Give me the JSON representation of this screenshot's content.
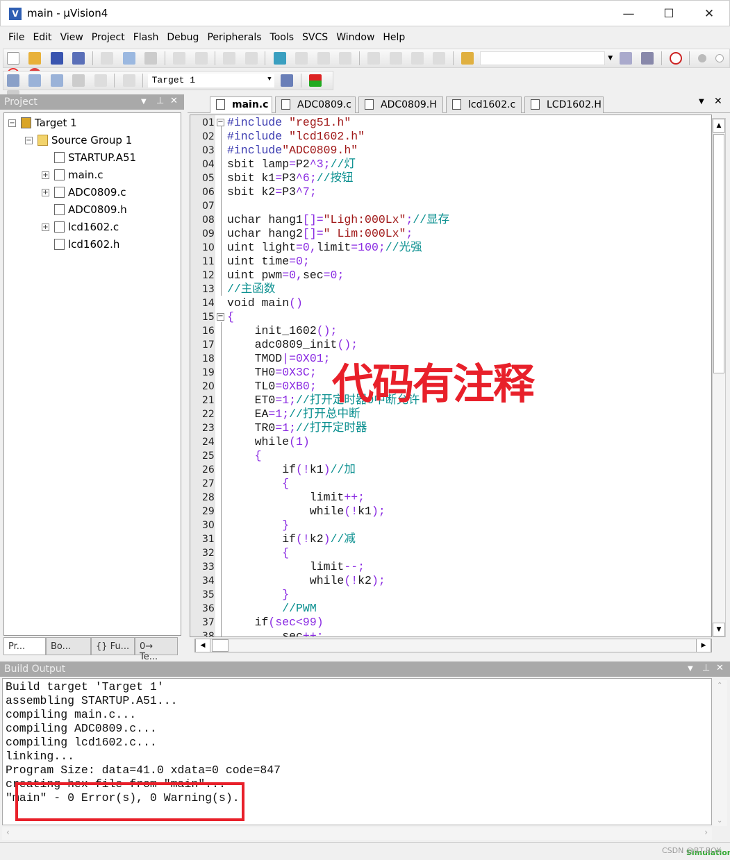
{
  "window": {
    "title": "main  - µVision4",
    "app_icon": "uv4-icon",
    "controls": [
      "minimize",
      "maximize",
      "close"
    ]
  },
  "menu": [
    "File",
    "Edit",
    "View",
    "Project",
    "Flash",
    "Debug",
    "Peripherals",
    "Tools",
    "SVCS",
    "Window",
    "Help"
  ],
  "toolbar2": {
    "target_select": "Target 1"
  },
  "project_panel": {
    "title": "Project",
    "tree": [
      {
        "label": "Target 1",
        "level": 0,
        "expander": "-"
      },
      {
        "label": "Source Group 1",
        "level": 1,
        "expander": "-"
      },
      {
        "label": "STARTUP.A51",
        "level": 2,
        "expander": ""
      },
      {
        "label": "main.c",
        "level": 2,
        "expander": "+"
      },
      {
        "label": "ADC0809.c",
        "level": 2,
        "expander": "+"
      },
      {
        "label": "ADC0809.h",
        "level": 2,
        "expander": ""
      },
      {
        "label": "lcd1602.c",
        "level": 2,
        "expander": "+"
      },
      {
        "label": "lcd1602.h",
        "level": 2,
        "expander": ""
      }
    ],
    "tabs": [
      "Pr...",
      "Bo...",
      "{} Fu...",
      "0→ Te..."
    ]
  },
  "editor": {
    "tabs": [
      "main.c",
      "ADC0809.c",
      "ADC0809.H",
      "lcd1602.c",
      "LCD1602.H"
    ],
    "active_tab": "main.c",
    "lines": [
      {
        "n": "01",
        "f": "-",
        "t": [
          [
            "p",
            "#include "
          ],
          [
            "s",
            "\"reg51.h\""
          ]
        ]
      },
      {
        "n": "02",
        "t": [
          [
            "p",
            "#include "
          ],
          [
            "s",
            "\"lcd1602.h\""
          ]
        ]
      },
      {
        "n": "03",
        "t": [
          [
            "p",
            "#include"
          ],
          [
            "s",
            "\"ADC0809.h\""
          ]
        ]
      },
      {
        "n": "04",
        "t": [
          [
            "k",
            "sbit lamp"
          ],
          [
            "o",
            "="
          ],
          [
            "k",
            "P2"
          ],
          [
            "o",
            "^3;"
          ],
          [
            "c",
            "//灯"
          ]
        ]
      },
      {
        "n": "05",
        "t": [
          [
            "k",
            "sbit k1"
          ],
          [
            "o",
            "="
          ],
          [
            "k",
            "P3"
          ],
          [
            "o",
            "^6;"
          ],
          [
            "c",
            "//按钮"
          ]
        ]
      },
      {
        "n": "06",
        "t": [
          [
            "k",
            "sbit k2"
          ],
          [
            "o",
            "="
          ],
          [
            "k",
            "P3"
          ],
          [
            "o",
            "^7;"
          ]
        ]
      },
      {
        "n": "07",
        "t": []
      },
      {
        "n": "08",
        "t": [
          [
            "k",
            "uchar hang1"
          ],
          [
            "o",
            "[]="
          ],
          [
            "s",
            "\"Ligh:000Lx\""
          ],
          [
            "o",
            ";"
          ],
          [
            "c",
            "//显存"
          ]
        ]
      },
      {
        "n": "09",
        "t": [
          [
            "k",
            "uchar hang2"
          ],
          [
            "o",
            "[]="
          ],
          [
            "s",
            "\" Lim:000Lx\""
          ],
          [
            "o",
            ";"
          ]
        ]
      },
      {
        "n": "10",
        "t": [
          [
            "k",
            "uint light"
          ],
          [
            "o",
            "=0,"
          ],
          [
            "k",
            "limit"
          ],
          [
            "o",
            "=100;"
          ],
          [
            "c",
            "//光强"
          ]
        ]
      },
      {
        "n": "11",
        "t": [
          [
            "k",
            "uint time"
          ],
          [
            "o",
            "=0;"
          ]
        ]
      },
      {
        "n": "12",
        "t": [
          [
            "k",
            "uint pwm"
          ],
          [
            "o",
            "=0,"
          ],
          [
            "k",
            "sec"
          ],
          [
            "o",
            "=0;"
          ]
        ]
      },
      {
        "n": "13",
        "t": [
          [
            "c",
            "//主函数"
          ]
        ]
      },
      {
        "n": "14",
        "t": [
          [
            "k",
            "void main"
          ],
          [
            "o",
            "()"
          ]
        ]
      },
      {
        "n": "15",
        "f": "-",
        "t": [
          [
            "o",
            "{"
          ]
        ]
      },
      {
        "n": "16",
        "t": [
          [
            "k",
            "    init_1602"
          ],
          [
            "o",
            "();"
          ]
        ]
      },
      {
        "n": "17",
        "t": [
          [
            "k",
            "    adc0809_init"
          ],
          [
            "o",
            "();"
          ]
        ]
      },
      {
        "n": "18",
        "t": [
          [
            "k",
            "    TMOD"
          ],
          [
            "o",
            "|=0X01;"
          ]
        ]
      },
      {
        "n": "19",
        "t": [
          [
            "k",
            "    TH0"
          ],
          [
            "o",
            "=0X3C;"
          ]
        ]
      },
      {
        "n": "20",
        "t": [
          [
            "k",
            "    TL0"
          ],
          [
            "o",
            "=0XB0;"
          ]
        ]
      },
      {
        "n": "21",
        "t": [
          [
            "k",
            "    ET0"
          ],
          [
            "o",
            "=1;"
          ],
          [
            "c",
            "//打开定时器0中断允许"
          ]
        ]
      },
      {
        "n": "22",
        "t": [
          [
            "k",
            "    EA"
          ],
          [
            "o",
            "=1;"
          ],
          [
            "c",
            "//打开总中断"
          ]
        ]
      },
      {
        "n": "23",
        "t": [
          [
            "k",
            "    TR0"
          ],
          [
            "o",
            "=1;"
          ],
          [
            "c",
            "//打开定时器"
          ]
        ]
      },
      {
        "n": "24",
        "t": [
          [
            "k",
            "    while"
          ],
          [
            "o",
            "(1)"
          ]
        ]
      },
      {
        "n": "25",
        "t": [
          [
            "o",
            "    {"
          ]
        ]
      },
      {
        "n": "26",
        "t": [
          [
            "k",
            "        if"
          ],
          [
            "o",
            "(!"
          ],
          [
            "k",
            "k1"
          ],
          [
            "o",
            ")"
          ],
          [
            "c",
            "//加"
          ]
        ]
      },
      {
        "n": "27",
        "t": [
          [
            "o",
            "        {"
          ]
        ]
      },
      {
        "n": "28",
        "t": [
          [
            "k",
            "            limit"
          ],
          [
            "o",
            "++;"
          ]
        ]
      },
      {
        "n": "29",
        "t": [
          [
            "k",
            "            while"
          ],
          [
            "o",
            "(!"
          ],
          [
            "k",
            "k1"
          ],
          [
            "o",
            ");"
          ]
        ]
      },
      {
        "n": "30",
        "t": [
          [
            "o",
            "        }"
          ]
        ]
      },
      {
        "n": "31",
        "t": [
          [
            "k",
            "        if"
          ],
          [
            "o",
            "(!"
          ],
          [
            "k",
            "k2"
          ],
          [
            "o",
            ")"
          ],
          [
            "c",
            "//减"
          ]
        ]
      },
      {
        "n": "32",
        "t": [
          [
            "o",
            "        {"
          ]
        ]
      },
      {
        "n": "33",
        "t": [
          [
            "k",
            "            limit"
          ],
          [
            "o",
            "--;"
          ]
        ]
      },
      {
        "n": "34",
        "t": [
          [
            "k",
            "            while"
          ],
          [
            "o",
            "(!"
          ],
          [
            "k",
            "k2"
          ],
          [
            "o",
            ");"
          ]
        ]
      },
      {
        "n": "35",
        "t": [
          [
            "o",
            "        }"
          ]
        ]
      },
      {
        "n": "36",
        "t": [
          [
            "c",
            "        //PWM"
          ]
        ]
      },
      {
        "n": "37",
        "t": [
          [
            "k",
            "    if"
          ],
          [
            "o",
            "(sec<99)"
          ]
        ]
      },
      {
        "n": "38",
        "t": [
          [
            "k",
            "        sec"
          ],
          [
            "o",
            "++;"
          ]
        ]
      }
    ]
  },
  "annotation": {
    "text": "代码有注释",
    "color": "#e8202a"
  },
  "build_output": {
    "title": "Build Output",
    "lines": [
      "Build target 'Target 1'",
      "assembling STARTUP.A51...",
      "compiling main.c...",
      "compiling ADC0809.c...",
      "compiling lcd1602.c...",
      "linking...",
      "Program Size: data=41.0 xdata=0 code=847",
      "creating hex file from \"main\"...",
      "\"main\" - 0 Error(s), 0 Warning(s)."
    ]
  },
  "status": {
    "watermark": "CSDN @BT-BOX",
    "simulation": "Simulation"
  },
  "colors": {
    "preprocessor": "#3b3bb0",
    "string": "#a01818",
    "number_operator": "#8a2be2",
    "comment": "#0b9090",
    "panel_header": "#a9a9a9"
  }
}
